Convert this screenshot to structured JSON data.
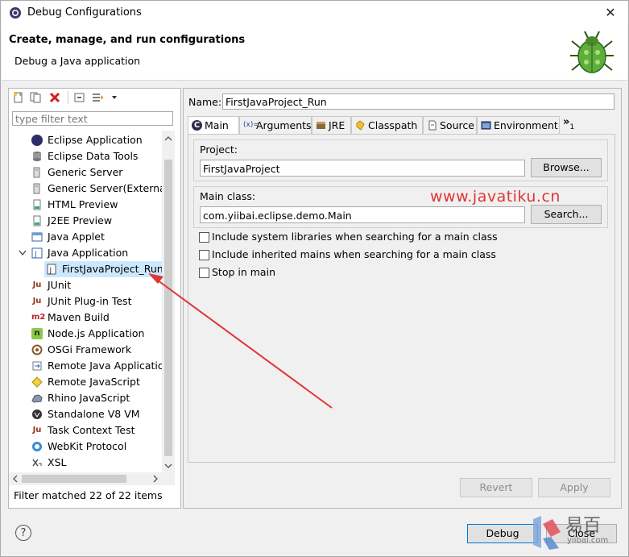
{
  "window": {
    "title": "Debug Configurations",
    "close_glyph": "✕"
  },
  "header": {
    "title": "Create, manage, and run configurations",
    "subtitle": "Debug a Java application"
  },
  "left": {
    "filter_placeholder": "type filter text",
    "status": "Filter matched 22 of 22 items",
    "tree": [
      {
        "label": "Eclipse Application",
        "icon": "eclipse-icon"
      },
      {
        "label": "Eclipse Data Tools",
        "icon": "database-icon"
      },
      {
        "label": "Generic Server",
        "icon": "server-icon"
      },
      {
        "label": "Generic Server(External La",
        "icon": "server-icon"
      },
      {
        "label": "HTML Preview",
        "icon": "html-icon"
      },
      {
        "label": "J2EE Preview",
        "icon": "j2ee-icon"
      },
      {
        "label": "Java Applet",
        "icon": "applet-icon"
      },
      {
        "label": "Java Application",
        "icon": "java-app-icon"
      },
      {
        "label": "FirstJavaProject_Run",
        "icon": "java-file-icon"
      },
      {
        "label": "JUnit",
        "icon": "junit-icon"
      },
      {
        "label": "JUnit Plug-in Test",
        "icon": "junit-plugin-icon"
      },
      {
        "label": "Maven Build",
        "icon": "maven-icon"
      },
      {
        "label": "Node.js Application",
        "icon": "nodejs-icon"
      },
      {
        "label": "OSGi Framework",
        "icon": "osgi-icon"
      },
      {
        "label": "Remote Java Application",
        "icon": "remote-java-icon"
      },
      {
        "label": "Remote JavaScript",
        "icon": "remote-js-icon"
      },
      {
        "label": "Rhino JavaScript",
        "icon": "rhino-icon"
      },
      {
        "label": "Standalone V8 VM",
        "icon": "v8-icon"
      },
      {
        "label": "Task Context Test",
        "icon": "task-context-icon"
      },
      {
        "label": "WebKit Protocol",
        "icon": "webkit-icon"
      },
      {
        "label": "XSL",
        "icon": "xsl-icon"
      }
    ]
  },
  "right": {
    "name_label": "Name:",
    "name_value": "FirstJavaProject_Run",
    "tabs": [
      {
        "label": "Main"
      },
      {
        "label": "Arguments"
      },
      {
        "label": "JRE"
      },
      {
        "label": "Classpath"
      },
      {
        "label": "Source"
      },
      {
        "label": "Environment"
      }
    ],
    "tab_overflow": "»",
    "tab_overflow_count": "1",
    "project": {
      "label": "Project:",
      "value": "FirstJavaProject",
      "button": "Browse..."
    },
    "main_class": {
      "label": "Main class:",
      "value": "com.yiibai.eclipse.demo.Main",
      "button": "Search..."
    },
    "checkboxes": [
      {
        "label": "Include system libraries when searching for a main class",
        "checked": false
      },
      {
        "label": "Include inherited mains when searching for a main class",
        "checked": false
      },
      {
        "label": "Stop in main",
        "checked": false
      }
    ],
    "revert": "Revert",
    "apply": "Apply"
  },
  "footer": {
    "help": "?",
    "debug": "Debug",
    "close": "Close"
  },
  "overlay": {
    "watermark": "www.javatiku.cn",
    "logo_text": "易百",
    "logo_sub": "yiibai.com"
  },
  "colors": {
    "arrow": "#e03535",
    "selected_bg": "#cce8ff",
    "accent": "#0078d7"
  }
}
